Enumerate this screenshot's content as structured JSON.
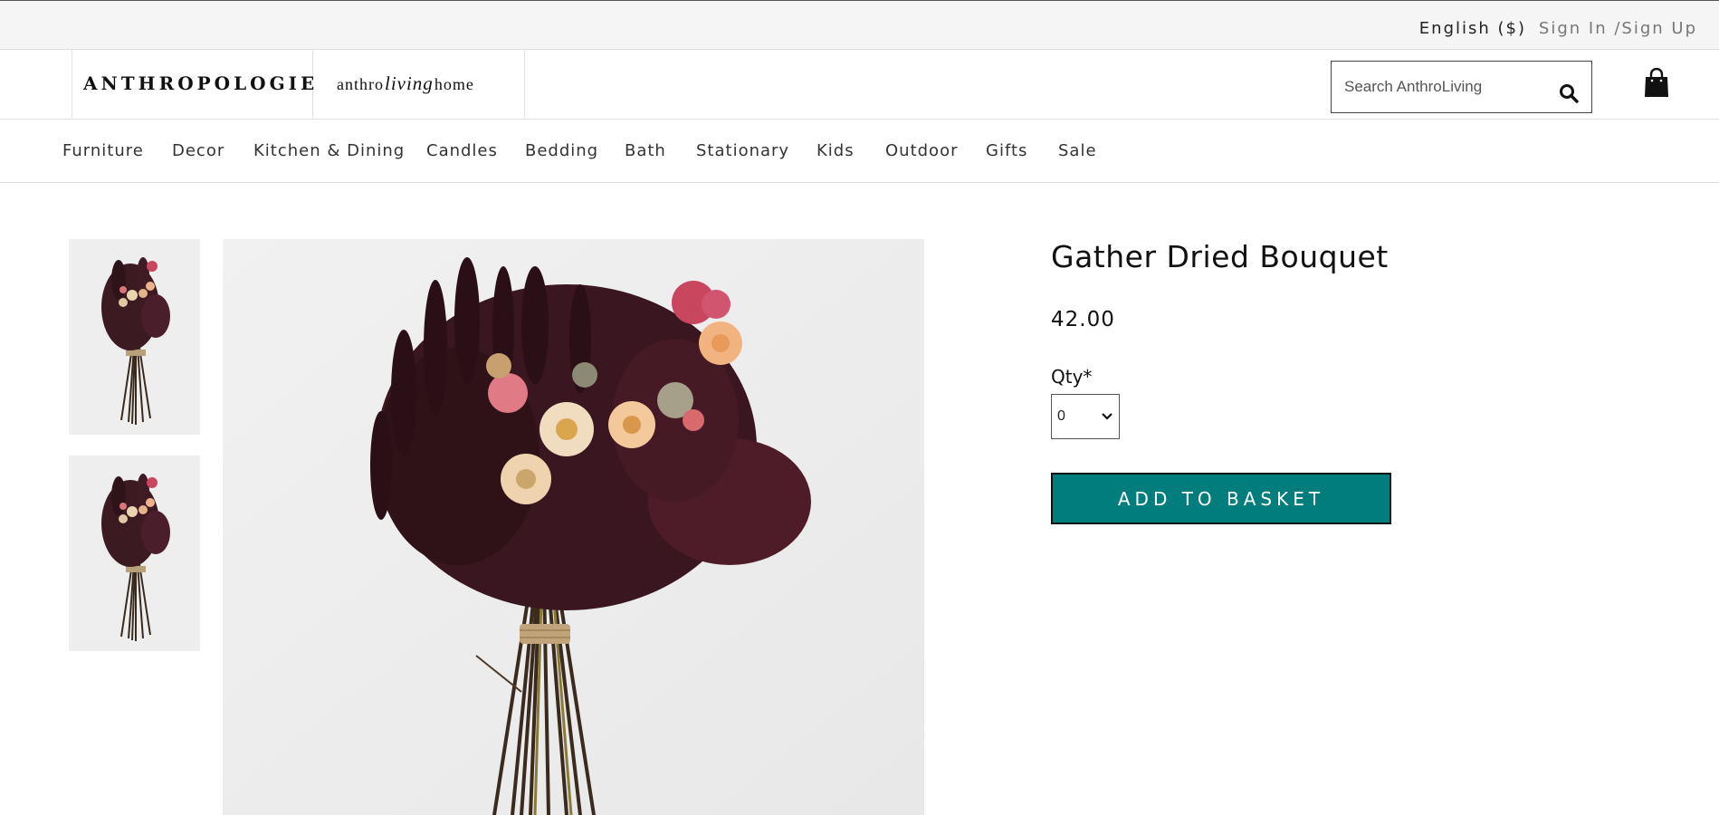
{
  "topbar": {
    "language": "English ($)",
    "auth": "Sign In /Sign Up"
  },
  "header": {
    "logo": "ANTHROPOLOGIE",
    "living_logo": {
      "left": "anthro",
      "script": "living",
      "right": "home"
    },
    "search_placeholder": "Search AnthroLiving"
  },
  "nav": {
    "items": [
      "Furniture",
      "Decor",
      "Kitchen & Dining",
      "Candles",
      "Bedding",
      "Bath",
      "Stationary",
      "Kids",
      "Outdoor",
      "Gifts",
      "Sale"
    ]
  },
  "product": {
    "title": "Gather Dried Bouquet",
    "price": "42.00",
    "qty_label": "Qty*",
    "qty_value": "0",
    "add_button": "ADD TO BASKET",
    "accent_color": "#017d7d"
  },
  "icons": {
    "search": "search-icon",
    "bag": "shopping-bag-icon",
    "chevron": "chevron-down-icon"
  }
}
